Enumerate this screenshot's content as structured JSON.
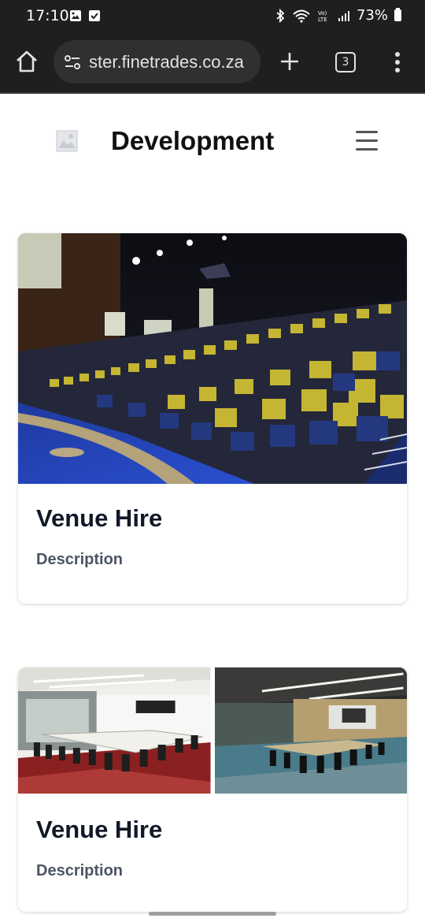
{
  "status_bar": {
    "time": "17:10",
    "battery": "73%",
    "icons": [
      "image-icon",
      "checkbox-icon",
      "bluetooth-icon",
      "wifi-icon",
      "volte-icon",
      "signal-icon",
      "battery-icon"
    ]
  },
  "browser": {
    "url": "ster.finetrades.co.za",
    "tab_count": "3",
    "icons": [
      "home-icon",
      "tune-icon",
      "plus-icon",
      "tabs-icon",
      "more-vert-icon"
    ]
  },
  "site": {
    "title": "Development",
    "logo_icon": "broken-image-icon",
    "menu_icon": "hamburger-icon"
  },
  "cards": [
    {
      "title": "Venue Hire",
      "description": "Description",
      "image": "auditorium-photo"
    },
    {
      "title": "Venue Hire",
      "description": "Description",
      "images": [
        "boardroom-photo-1",
        "boardroom-photo-2"
      ]
    }
  ],
  "colors": {
    "status_bar_bg": "#1f1f1f",
    "url_pill_bg": "#303030",
    "title_text": "#111827",
    "desc_text": "#4b5563"
  }
}
